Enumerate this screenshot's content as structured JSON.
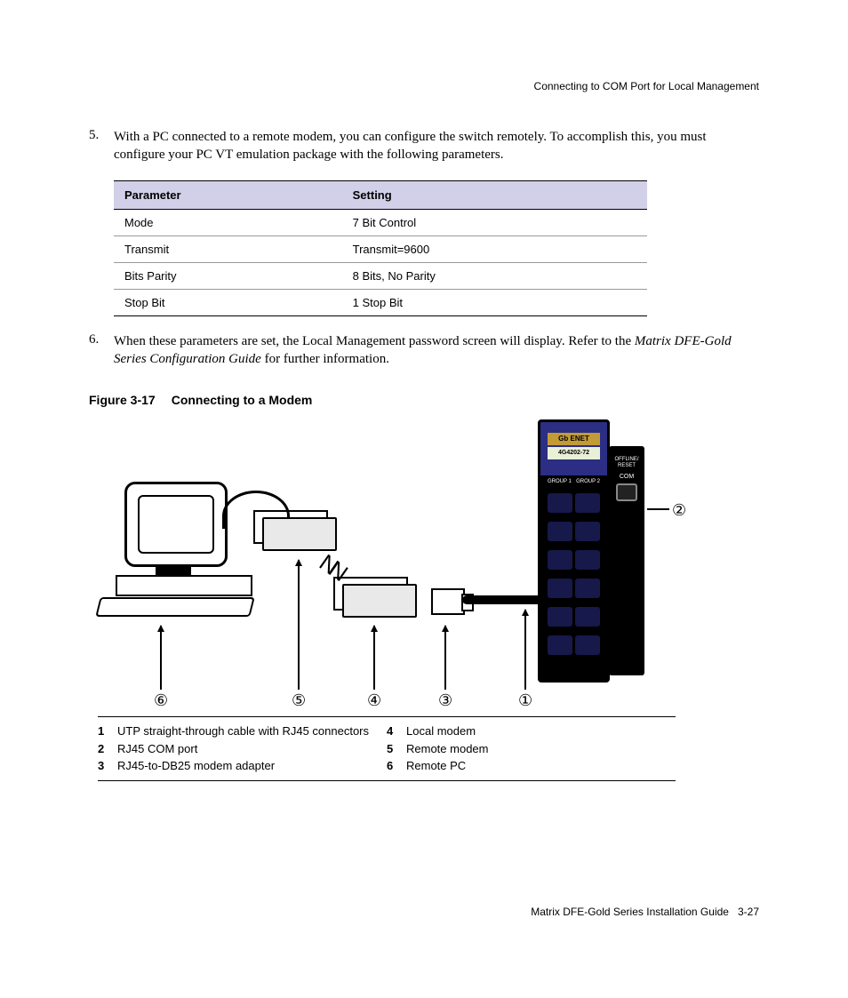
{
  "header": {
    "running_head": "Connecting to COM Port for Local Management"
  },
  "steps": {
    "s5": {
      "num": "5.",
      "text": "With a PC connected to a remote modem, you can configure the switch remotely. To accomplish this, you must configure your PC VT emulation package with the following parameters."
    },
    "s6": {
      "num": "6.",
      "text_a": "When these parameters are set, the Local Management password screen will display. Refer to the ",
      "text_italic": "Matrix DFE-Gold Series Configuration Guide",
      "text_b": " for further information."
    }
  },
  "table": {
    "head_param": "Parameter",
    "head_setting": "Setting",
    "rows": [
      {
        "param": "Mode",
        "setting": "7 Bit Control"
      },
      {
        "param": "Transmit",
        "setting": "Transmit=9600"
      },
      {
        "param": "Bits Parity",
        "setting": "8 Bits, No Parity"
      },
      {
        "param": "Stop Bit",
        "setting": "1 Stop Bit"
      }
    ]
  },
  "figure": {
    "label": "Figure 3-17",
    "title": "Connecting to a Modem",
    "switch_label1": "Gb ENET",
    "switch_label2": "4G4202-72",
    "group1": "GROUP 1",
    "group2": "GROUP 2",
    "side_lbl": "OFFLINE/\nRESET",
    "side_com": "COM",
    "callouts": {
      "c1": "①",
      "c2": "②",
      "c3": "③",
      "c4": "④",
      "c5": "⑤",
      "c6": "⑥"
    }
  },
  "legend": {
    "r1": {
      "n": "1",
      "t": "UTP straight-through cable with RJ45 connectors"
    },
    "r2": {
      "n": "2",
      "t": "RJ45 COM port"
    },
    "r3": {
      "n": "3",
      "t": "RJ45-to-DB25 modem adapter"
    },
    "r4": {
      "n": "4",
      "t": "Local modem"
    },
    "r5": {
      "n": "5",
      "t": "Remote modem"
    },
    "r6": {
      "n": "6",
      "t": "Remote PC"
    }
  },
  "footer": {
    "text": "Matrix DFE-Gold Series Installation Guide",
    "page": "3-27"
  }
}
